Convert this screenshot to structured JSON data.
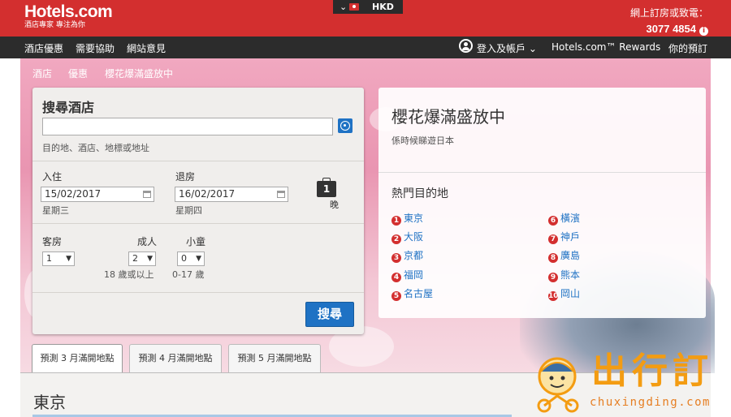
{
  "header": {
    "logo_text": "Hotels.com",
    "logo_tagline": "酒店專家 專注為你",
    "locale_currency": "HKD",
    "phone_label": "網上訂房或致電：",
    "phone_number": "3077 4854"
  },
  "nav": {
    "left": [
      "酒店優惠",
      "需要協助",
      "網站意見"
    ],
    "account": "登入及帳戶",
    "rewards": "Hotels.com™ Rewards",
    "bookings": "你的預訂"
  },
  "breadcrumbs": [
    "酒店",
    "優惠",
    "櫻花爆滿盛放中"
  ],
  "search": {
    "title": "搜尋酒店",
    "destination_value": "",
    "destination_hint": "目的地、酒店、地標或地址",
    "checkin_label": "入住",
    "checkin_date": "15/02/2017",
    "checkin_day": "星期三",
    "checkout_label": "退房",
    "checkout_date": "16/02/2017",
    "checkout_day": "星期四",
    "nights_count": "1",
    "nights_label": "晚",
    "rooms_label": "客房",
    "rooms_value": "1",
    "adults_label": "成人",
    "adults_value": "2",
    "adults_hint": "18 歲或以上",
    "children_label": "小童",
    "children_value": "0",
    "children_hint": "0-17 歲",
    "submit_label": "搜尋"
  },
  "promo": {
    "title": "櫻花爆滿盛放中",
    "subtitle": "係時候睇遊日本",
    "popular_title": "熱門目的地",
    "destinations": [
      {
        "num": "1",
        "name": "東京"
      },
      {
        "num": "2",
        "name": "大阪"
      },
      {
        "num": "3",
        "name": "京都"
      },
      {
        "num": "4",
        "name": "福岡"
      },
      {
        "num": "5",
        "name": "名古屋"
      },
      {
        "num": "6",
        "name": "橫濱"
      },
      {
        "num": "7",
        "name": "神戶"
      },
      {
        "num": "8",
        "name": "廣島"
      },
      {
        "num": "9",
        "name": "熊本"
      },
      {
        "num": "10",
        "name": "岡山"
      }
    ]
  },
  "tabs": [
    "預測 3 月滿開地點",
    "預測 4 月滿開地點",
    "預測 5 月滿開地點"
  ],
  "content": {
    "city_heading": "東京"
  },
  "watermark": {
    "text": "出行訂",
    "url": "chuxingding.com"
  },
  "colors": {
    "brand_red": "#d32f2f",
    "nav_dark": "#2c2c2c",
    "link_blue": "#1f72c4",
    "watermark_orange": "#f39c12"
  }
}
